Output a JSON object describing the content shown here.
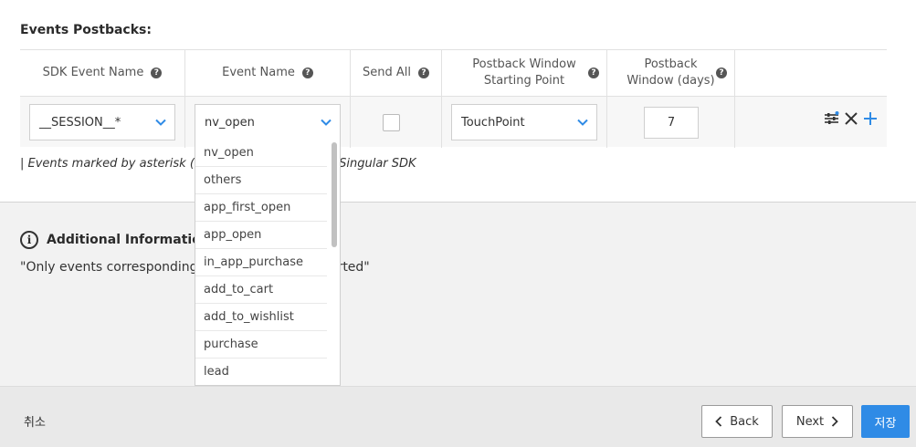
{
  "section": {
    "title": "Events Postbacks:"
  },
  "columns": {
    "sdk_event_name": "SDK Event Name",
    "event_name": "Event Name",
    "send_all": "Send All",
    "postback_start_line1": "Postback Window",
    "postback_start_line2": "Starting Point",
    "postback_days_line1": "Postback",
    "postback_days_line2": "Window (days)",
    "help_glyph": "?"
  },
  "row": {
    "sdk_event_value": "__SESSION__*",
    "event_name_value": "nv_open",
    "send_all_checked": false,
    "starting_point_value": "TouchPoint",
    "window_days_value": "7"
  },
  "dropdown": {
    "options": [
      "nv_open",
      "others",
      "app_first_open",
      "app_open",
      "in_app_purchase",
      "add_to_cart",
      "add_to_wishlist",
      "purchase",
      "lead"
    ]
  },
  "notes": {
    "asterisk_note_start": "| Events marked by asterisk (*)",
    "asterisk_note_end": "e Singular SDK"
  },
  "info": {
    "title": "Additional Information",
    "icon_glyph": "i",
    "text_start": "\"Only events corresponding t",
    "text_end": "orted\""
  },
  "footer": {
    "cancel_label": "취소",
    "back_label": "Back",
    "next_label": "Next",
    "save_label": "저장"
  },
  "colors": {
    "accent": "#2f8be6",
    "chevron": "#2f8be6"
  },
  "icons": [
    "help-icon",
    "chevron-down-icon",
    "sliders-icon",
    "close-icon",
    "plus-icon",
    "info-icon",
    "chevron-left-icon",
    "chevron-right-icon"
  ]
}
